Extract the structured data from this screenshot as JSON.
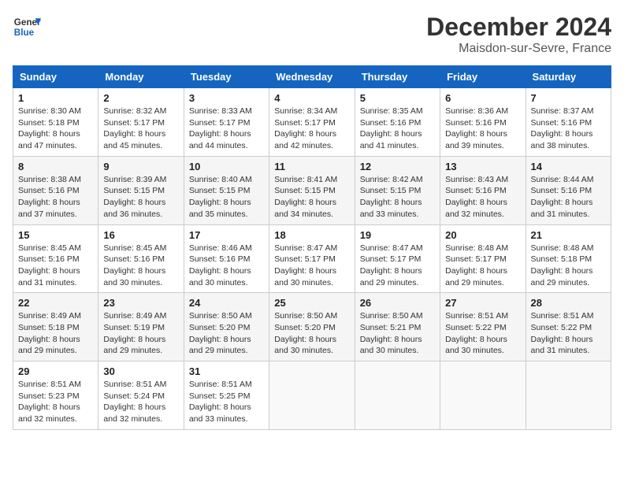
{
  "header": {
    "logo_line1": "General",
    "logo_line2": "Blue",
    "month": "December 2024",
    "location": "Maisdon-sur-Sevre, France"
  },
  "weekdays": [
    "Sunday",
    "Monday",
    "Tuesday",
    "Wednesday",
    "Thursday",
    "Friday",
    "Saturday"
  ],
  "weeks": [
    [
      {
        "day": "1",
        "sunrise": "Sunrise: 8:30 AM",
        "sunset": "Sunset: 5:18 PM",
        "daylight": "Daylight: 8 hours and 47 minutes."
      },
      {
        "day": "2",
        "sunrise": "Sunrise: 8:32 AM",
        "sunset": "Sunset: 5:17 PM",
        "daylight": "Daylight: 8 hours and 45 minutes."
      },
      {
        "day": "3",
        "sunrise": "Sunrise: 8:33 AM",
        "sunset": "Sunset: 5:17 PM",
        "daylight": "Daylight: 8 hours and 44 minutes."
      },
      {
        "day": "4",
        "sunrise": "Sunrise: 8:34 AM",
        "sunset": "Sunset: 5:17 PM",
        "daylight": "Daylight: 8 hours and 42 minutes."
      },
      {
        "day": "5",
        "sunrise": "Sunrise: 8:35 AM",
        "sunset": "Sunset: 5:16 PM",
        "daylight": "Daylight: 8 hours and 41 minutes."
      },
      {
        "day": "6",
        "sunrise": "Sunrise: 8:36 AM",
        "sunset": "Sunset: 5:16 PM",
        "daylight": "Daylight: 8 hours and 39 minutes."
      },
      {
        "day": "7",
        "sunrise": "Sunrise: 8:37 AM",
        "sunset": "Sunset: 5:16 PM",
        "daylight": "Daylight: 8 hours and 38 minutes."
      }
    ],
    [
      {
        "day": "8",
        "sunrise": "Sunrise: 8:38 AM",
        "sunset": "Sunset: 5:16 PM",
        "daylight": "Daylight: 8 hours and 37 minutes."
      },
      {
        "day": "9",
        "sunrise": "Sunrise: 8:39 AM",
        "sunset": "Sunset: 5:15 PM",
        "daylight": "Daylight: 8 hours and 36 minutes."
      },
      {
        "day": "10",
        "sunrise": "Sunrise: 8:40 AM",
        "sunset": "Sunset: 5:15 PM",
        "daylight": "Daylight: 8 hours and 35 minutes."
      },
      {
        "day": "11",
        "sunrise": "Sunrise: 8:41 AM",
        "sunset": "Sunset: 5:15 PM",
        "daylight": "Daylight: 8 hours and 34 minutes."
      },
      {
        "day": "12",
        "sunrise": "Sunrise: 8:42 AM",
        "sunset": "Sunset: 5:15 PM",
        "daylight": "Daylight: 8 hours and 33 minutes."
      },
      {
        "day": "13",
        "sunrise": "Sunrise: 8:43 AM",
        "sunset": "Sunset: 5:16 PM",
        "daylight": "Daylight: 8 hours and 32 minutes."
      },
      {
        "day": "14",
        "sunrise": "Sunrise: 8:44 AM",
        "sunset": "Sunset: 5:16 PM",
        "daylight": "Daylight: 8 hours and 31 minutes."
      }
    ],
    [
      {
        "day": "15",
        "sunrise": "Sunrise: 8:45 AM",
        "sunset": "Sunset: 5:16 PM",
        "daylight": "Daylight: 8 hours and 31 minutes."
      },
      {
        "day": "16",
        "sunrise": "Sunrise: 8:45 AM",
        "sunset": "Sunset: 5:16 PM",
        "daylight": "Daylight: 8 hours and 30 minutes."
      },
      {
        "day": "17",
        "sunrise": "Sunrise: 8:46 AM",
        "sunset": "Sunset: 5:16 PM",
        "daylight": "Daylight: 8 hours and 30 minutes."
      },
      {
        "day": "18",
        "sunrise": "Sunrise: 8:47 AM",
        "sunset": "Sunset: 5:17 PM",
        "daylight": "Daylight: 8 hours and 30 minutes."
      },
      {
        "day": "19",
        "sunrise": "Sunrise: 8:47 AM",
        "sunset": "Sunset: 5:17 PM",
        "daylight": "Daylight: 8 hours and 29 minutes."
      },
      {
        "day": "20",
        "sunrise": "Sunrise: 8:48 AM",
        "sunset": "Sunset: 5:17 PM",
        "daylight": "Daylight: 8 hours and 29 minutes."
      },
      {
        "day": "21",
        "sunrise": "Sunrise: 8:48 AM",
        "sunset": "Sunset: 5:18 PM",
        "daylight": "Daylight: 8 hours and 29 minutes."
      }
    ],
    [
      {
        "day": "22",
        "sunrise": "Sunrise: 8:49 AM",
        "sunset": "Sunset: 5:18 PM",
        "daylight": "Daylight: 8 hours and 29 minutes."
      },
      {
        "day": "23",
        "sunrise": "Sunrise: 8:49 AM",
        "sunset": "Sunset: 5:19 PM",
        "daylight": "Daylight: 8 hours and 29 minutes."
      },
      {
        "day": "24",
        "sunrise": "Sunrise: 8:50 AM",
        "sunset": "Sunset: 5:20 PM",
        "daylight": "Daylight: 8 hours and 29 minutes."
      },
      {
        "day": "25",
        "sunrise": "Sunrise: 8:50 AM",
        "sunset": "Sunset: 5:20 PM",
        "daylight": "Daylight: 8 hours and 30 minutes."
      },
      {
        "day": "26",
        "sunrise": "Sunrise: 8:50 AM",
        "sunset": "Sunset: 5:21 PM",
        "daylight": "Daylight: 8 hours and 30 minutes."
      },
      {
        "day": "27",
        "sunrise": "Sunrise: 8:51 AM",
        "sunset": "Sunset: 5:22 PM",
        "daylight": "Daylight: 8 hours and 30 minutes."
      },
      {
        "day": "28",
        "sunrise": "Sunrise: 8:51 AM",
        "sunset": "Sunset: 5:22 PM",
        "daylight": "Daylight: 8 hours and 31 minutes."
      }
    ],
    [
      {
        "day": "29",
        "sunrise": "Sunrise: 8:51 AM",
        "sunset": "Sunset: 5:23 PM",
        "daylight": "Daylight: 8 hours and 32 minutes."
      },
      {
        "day": "30",
        "sunrise": "Sunrise: 8:51 AM",
        "sunset": "Sunset: 5:24 PM",
        "daylight": "Daylight: 8 hours and 32 minutes."
      },
      {
        "day": "31",
        "sunrise": "Sunrise: 8:51 AM",
        "sunset": "Sunset: 5:25 PM",
        "daylight": "Daylight: 8 hours and 33 minutes."
      },
      null,
      null,
      null,
      null
    ]
  ]
}
